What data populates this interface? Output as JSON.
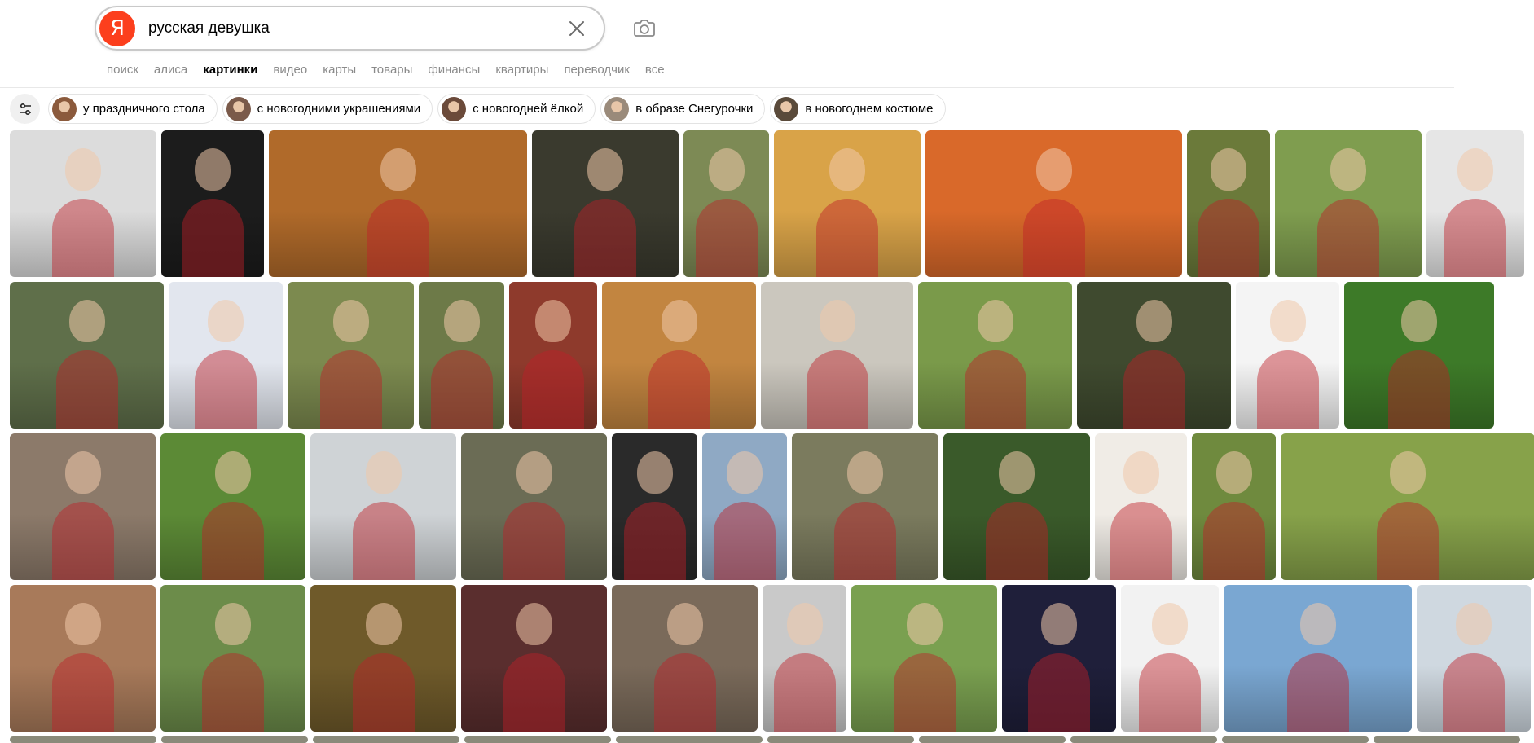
{
  "search": {
    "logo_letter": "Я",
    "query": "русская девушка",
    "clear_icon": "close-icon",
    "camera_icon": "camera-icon"
  },
  "tabs": [
    {
      "label": "поиск",
      "active": false
    },
    {
      "label": "алиса",
      "active": false
    },
    {
      "label": "картинки",
      "active": true
    },
    {
      "label": "видео",
      "active": false
    },
    {
      "label": "карты",
      "active": false
    },
    {
      "label": "товары",
      "active": false
    },
    {
      "label": "финансы",
      "active": false
    },
    {
      "label": "квартиры",
      "active": false
    },
    {
      "label": "переводчик",
      "active": false
    },
    {
      "label": "все",
      "active": false
    }
  ],
  "filters_icon": "sliders-icon",
  "chips": [
    {
      "label": "у праздничного стола"
    },
    {
      "label": "с новогодними украшениями"
    },
    {
      "label": "с новогодней ёлкой"
    },
    {
      "label": "в образе Снегурочки"
    },
    {
      "label": "в новогоднем костюме"
    }
  ],
  "colors": {
    "logo_red": "#fc3f1d",
    "accent_red": "#c8202b",
    "birch_white": "#e9e6df",
    "grass_green": "#5b8a2e",
    "sunset_orange": "#e88a2f",
    "sky_blue": "#6fa6d6"
  },
  "results": {
    "rows": [
      [
        "#dcdcdc",
        "#1c1c1c",
        "#b06a2a",
        "#3a3a2e",
        "#7d8a55",
        "#d9a348",
        "#d9692a",
        "#6b7a3a",
        "#7f9d4f",
        "#e6e6e6"
      ],
      [
        "#5f6f4a",
        "#e2e6ee",
        "#7c8a4f",
        "#6d7a48",
        "#8e3a2c",
        "#c28540",
        "#cbc7be",
        "#7a9a4a",
        "#3f4a2f",
        "#f4f4f4",
        "#3d7a28"
      ],
      [
        "#8c7a6a",
        "#5c8a36",
        "#cfd3d6",
        "#6b6c55",
        "#2a2a2a",
        "#8fa9c4",
        "#7b7b5e",
        "#3a5a2a",
        "#f0ece6",
        "#6f8a3e",
        "#87a24a"
      ],
      [
        "#a87a5a",
        "#6c8c4a",
        "#6f5a2a",
        "#5a2e2e",
        "#7a6a5a",
        "#c9c9c9",
        "#7aa050",
        "#1f1f3a",
        "#f2f2f2",
        "#7aa7d2",
        "#cfd8e0"
      ]
    ]
  }
}
